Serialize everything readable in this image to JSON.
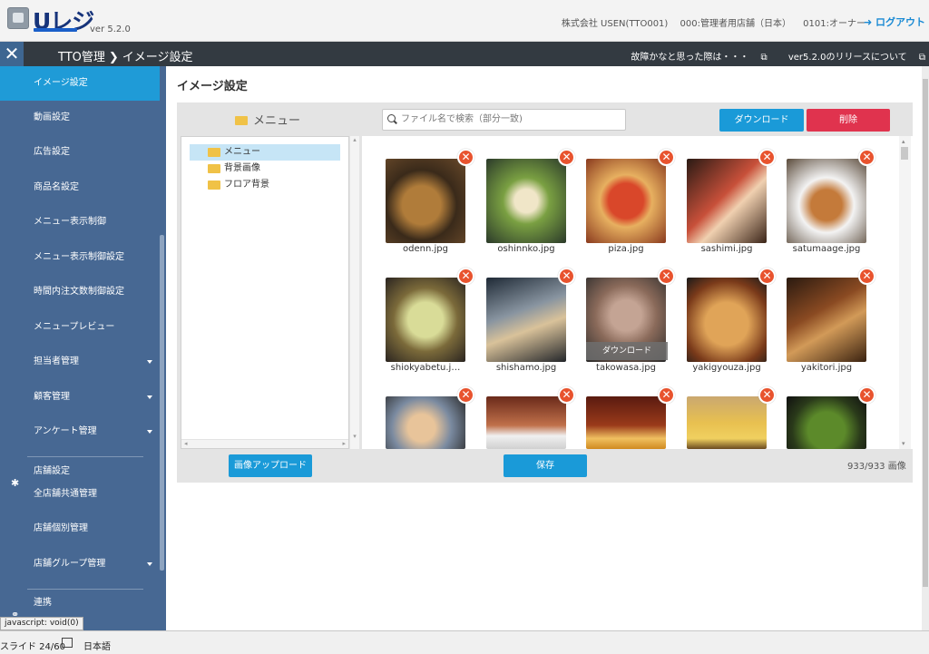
{
  "header": {
    "logo": "Uレジ",
    "version": "ver 5.2.0",
    "company": "株式会社 USEN(TTO001)",
    "store": "000:管理者用店舗（日本）",
    "user": "0101:オーナー",
    "logout": "ログアウト"
  },
  "navbar": {
    "close": "✕",
    "breadcrumb_parent": "TTO管理",
    "breadcrumb_sep": "❯",
    "breadcrumb_current": "イメージ設定",
    "link_issue": "故障かなと思った際は・・・",
    "link_release": "ver5.2.0のリリースについて"
  },
  "sidebar": {
    "items": [
      {
        "label": "イメージ設定"
      },
      {
        "label": "動画設定"
      },
      {
        "label": "広告設定"
      },
      {
        "label": "商品名設定"
      },
      {
        "label": "メニュー表示制御"
      },
      {
        "label": "メニュー表示制御設定"
      },
      {
        "label": "時間内注文数制御設定"
      },
      {
        "label": "メニュープレビュー"
      },
      {
        "label": "担当者管理"
      },
      {
        "label": "顧客管理"
      },
      {
        "label": "アンケート管理"
      },
      {
        "label": "店舗設定"
      },
      {
        "label": "全店舗共通管理"
      },
      {
        "label": "店舗個別管理"
      },
      {
        "label": "店舗グループ管理"
      },
      {
        "label": "連携"
      }
    ],
    "tooltip": "javascript: void(0)"
  },
  "main": {
    "title": "イメージ設定",
    "folder_title": "メニュー",
    "search_placeholder": "ファイル名で検索（部分一致)",
    "download_label": "ダウンロード",
    "delete_label": "削除",
    "folders": [
      {
        "label": "メニュー"
      },
      {
        "label": "背景画像"
      },
      {
        "label": "フロア背景"
      }
    ],
    "images": [
      {
        "name": "odenn.jpg"
      },
      {
        "name": "oshinnko.jpg"
      },
      {
        "name": "piza.jpg"
      },
      {
        "name": "sashimi.jpg"
      },
      {
        "name": "satumaage.jpg"
      },
      {
        "name": "shiokyabetu.j…"
      },
      {
        "name": "shishamo.jpg"
      },
      {
        "name": "takowasa.jpg"
      },
      {
        "name": "yakigyouza.jpg"
      },
      {
        "name": "yakitori.jpg"
      },
      {
        "name": ""
      },
      {
        "name": ""
      },
      {
        "name": ""
      },
      {
        "name": ""
      },
      {
        "name": ""
      }
    ],
    "hover_download": "ダウンロード",
    "upload_label": "画像アップロード",
    "save_label": "保存",
    "count": "933/933 画像"
  },
  "statusbar": {
    "slide": "スライド 24/60",
    "lang": "日本語"
  },
  "colors": {
    "sidebar": "#476893",
    "active": "#1f9bd7",
    "primary_button": "#1a9ad8",
    "danger_button": "#e0334e",
    "delete_badge": "#e8532e"
  }
}
